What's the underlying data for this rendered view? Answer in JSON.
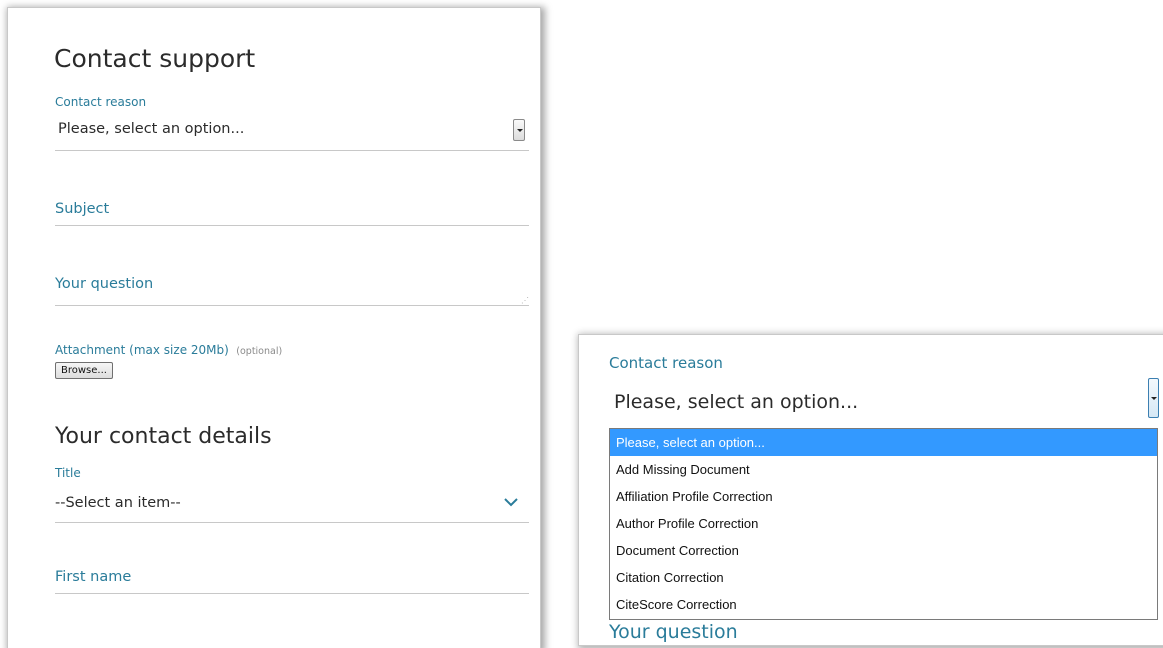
{
  "form": {
    "title": "Contact support",
    "contact_reason": {
      "label": "Contact reason",
      "value": "Please, select an option..."
    },
    "subject": {
      "label": "Subject"
    },
    "question": {
      "label": "Your question"
    },
    "attachment": {
      "label": "Attachment (max size 20Mb)",
      "optional": "(optional)",
      "browse_label": "Browse..."
    },
    "contact_details_heading": "Your contact details",
    "title_field": {
      "label": "Title",
      "value": "--Select an item--"
    },
    "first_name": {
      "label": "First name"
    }
  },
  "zoom": {
    "contact_reason_label": "Contact reason",
    "select_value": "Please, select an option...",
    "options": [
      "Please, select an option...",
      "Add Missing Document",
      "Affiliation Profile Correction",
      "Author Profile Correction",
      "Document Correction",
      "Citation Correction",
      "CiteScore Correction"
    ],
    "selected_index": 0,
    "partial_next_label": "Your question"
  },
  "colors": {
    "accent": "#2a7c9a",
    "highlight": "#3399ff"
  }
}
